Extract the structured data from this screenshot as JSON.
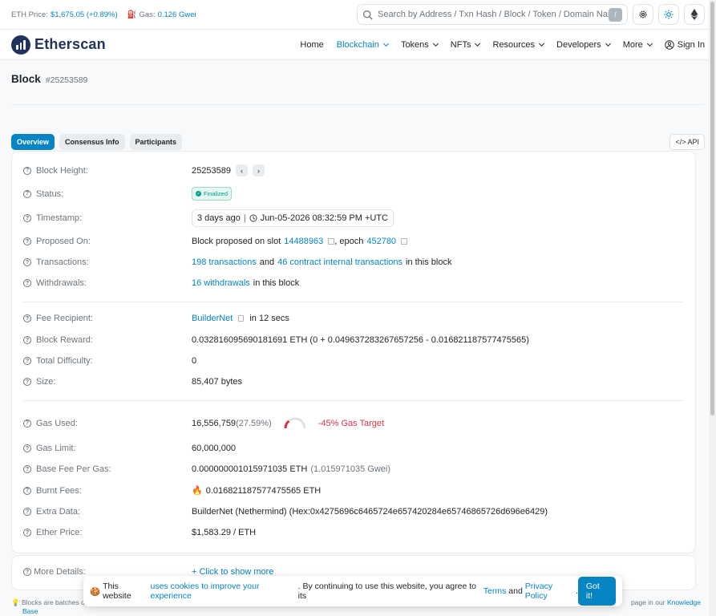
{
  "topbar": {
    "eth_price_label": "ETH Price:",
    "eth_price_value": "$1,675.05 (+0.89%)",
    "gas_label": "Gas:",
    "gas_value": "0.126 Gwei",
    "search_placeholder": "Search by Address / Txn Hash / Block / Token / Domain Name",
    "search_shortcut": "/"
  },
  "nav": {
    "logo_text": "Etherscan",
    "items": [
      {
        "label": "Home"
      },
      {
        "label": "Blockchain"
      },
      {
        "label": "Tokens"
      },
      {
        "label": "NFTs"
      },
      {
        "label": "Resources"
      },
      {
        "label": "Developers"
      },
      {
        "label": "More"
      }
    ],
    "sign_in": "Sign In"
  },
  "page": {
    "title": "Block",
    "block_number_tag": "#25253589"
  },
  "tabs": [
    {
      "label": "Overview"
    },
    {
      "label": "Consensus Info"
    },
    {
      "label": "Participants"
    }
  ],
  "api_label": "API",
  "overview": {
    "block_height": {
      "label": "Block Height:",
      "value": "25253589"
    },
    "status": {
      "label": "Status:",
      "value": "Finalized"
    },
    "timestamp": {
      "label": "Timestamp:",
      "ago": "3 days ago",
      "full": "Jun-05-2026 08:32:59 PM +UTC"
    },
    "proposed_on": {
      "label": "Proposed On:",
      "prefix": "Block proposed on slot",
      "slot": "14488963",
      "mid": ", epoch",
      "epoch": "452780"
    },
    "transactions": {
      "label": "Transactions:",
      "txns": "198 transactions",
      "and": "and",
      "internal": "46 contract internal transactions",
      "suffix": "in this block"
    },
    "withdrawals": {
      "label": "Withdrawals:",
      "link": "16 withdrawals",
      "suffix": "in this block"
    },
    "fee_recipient": {
      "label": "Fee Recipient:",
      "value": "BuilderNet",
      "suffix": "in 12 secs"
    },
    "block_reward": {
      "label": "Block Reward:",
      "value": "0.032816095690181691 ETH (0 + 0.049637283267657256 - 0.016821187577475565)"
    },
    "total_difficulty": {
      "label": "Total Difficulty:",
      "value": "0"
    },
    "size": {
      "label": "Size:",
      "value": "85,407 bytes"
    },
    "gas_used": {
      "label": "Gas Used:",
      "value": "16,556,759",
      "pct": "(27.59%)",
      "target": "-45% Gas Target",
      "usage_fraction": 0.2759
    },
    "gas_limit": {
      "label": "Gas Limit:",
      "value": "60,000,000"
    },
    "base_fee": {
      "label": "Base Fee Per Gas:",
      "value": "0.000000001015971035 ETH",
      "gwei": "(1.015971035 Gwei)"
    },
    "burnt_fees": {
      "label": "Burnt Fees:",
      "value": "0.016821187577475565 ETH"
    },
    "extra_data": {
      "label": "Extra Data:",
      "value": "BuilderNet (Nethermind) (Hex:0x4275696c6465724e657420284e65746865726d696e6429)"
    },
    "ether_price": {
      "label": "Ether Price:",
      "value": "$1,583.29 / ETH"
    }
  },
  "more_details": {
    "label": "More Details:",
    "link": "+ Click to show more"
  },
  "footnote": {
    "text": "Blocks are batches o",
    "tail": "page in our",
    "kb": "Knowledge",
    "kb2": "Base"
  },
  "cookie": {
    "pre": "This website",
    "link1": "uses cookies to improve your experience",
    "mid": ". By continuing to use this website, you agree to its",
    "terms": "Terms",
    "and": "and",
    "privacy": "Privacy Policy",
    "end": ".",
    "button": "Got it!"
  }
}
